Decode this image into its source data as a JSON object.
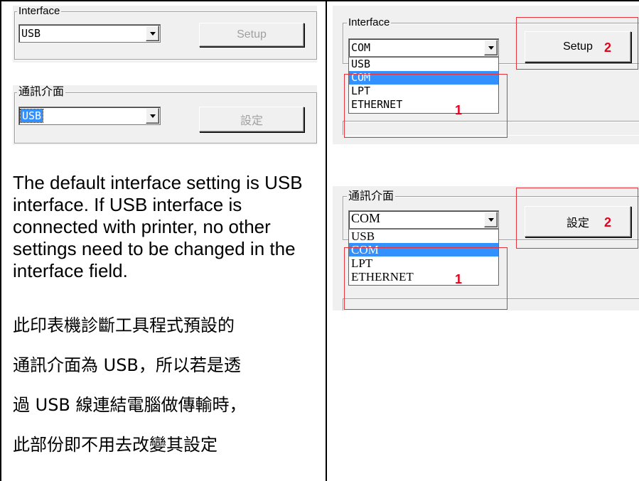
{
  "left_top": {
    "group_label": "Interface",
    "combo_value": "USB",
    "button_label": "Setup"
  },
  "left_bottom": {
    "group_label": "通訊介面",
    "combo_value": "USB",
    "button_label": "設定"
  },
  "description": {
    "english": "The default interface setting is USB interface. If USB interface is connected with printer, no other settings need to be changed in the interface field.",
    "chinese_lines": [
      "此印表機診斷工具程式預設的",
      "通訊介面為 USB，所以若是透",
      "過 USB 線連結電腦做傳輸時，",
      "此部份即不用去改變其設定"
    ]
  },
  "right_top": {
    "group_label": "Interface",
    "combo_value": "COM",
    "button_label": "Setup",
    "dropdown_options": [
      "USB",
      "COM",
      "LPT",
      "ETHERNET"
    ],
    "highlighted_option": "COM",
    "marker_1": "1",
    "marker_2": "2"
  },
  "right_bottom": {
    "group_label": "通訊介面",
    "combo_value": "COM",
    "button_label": "設定",
    "dropdown_options": [
      "USB",
      "COM",
      "LPT",
      "ETHERNET"
    ],
    "highlighted_option": "COM",
    "marker_1": "1",
    "marker_2": "2"
  },
  "colors": {
    "annotation_red": "#e8333a",
    "selection_blue": "#3390ff",
    "dialog_gray": "#f0f0f0"
  }
}
